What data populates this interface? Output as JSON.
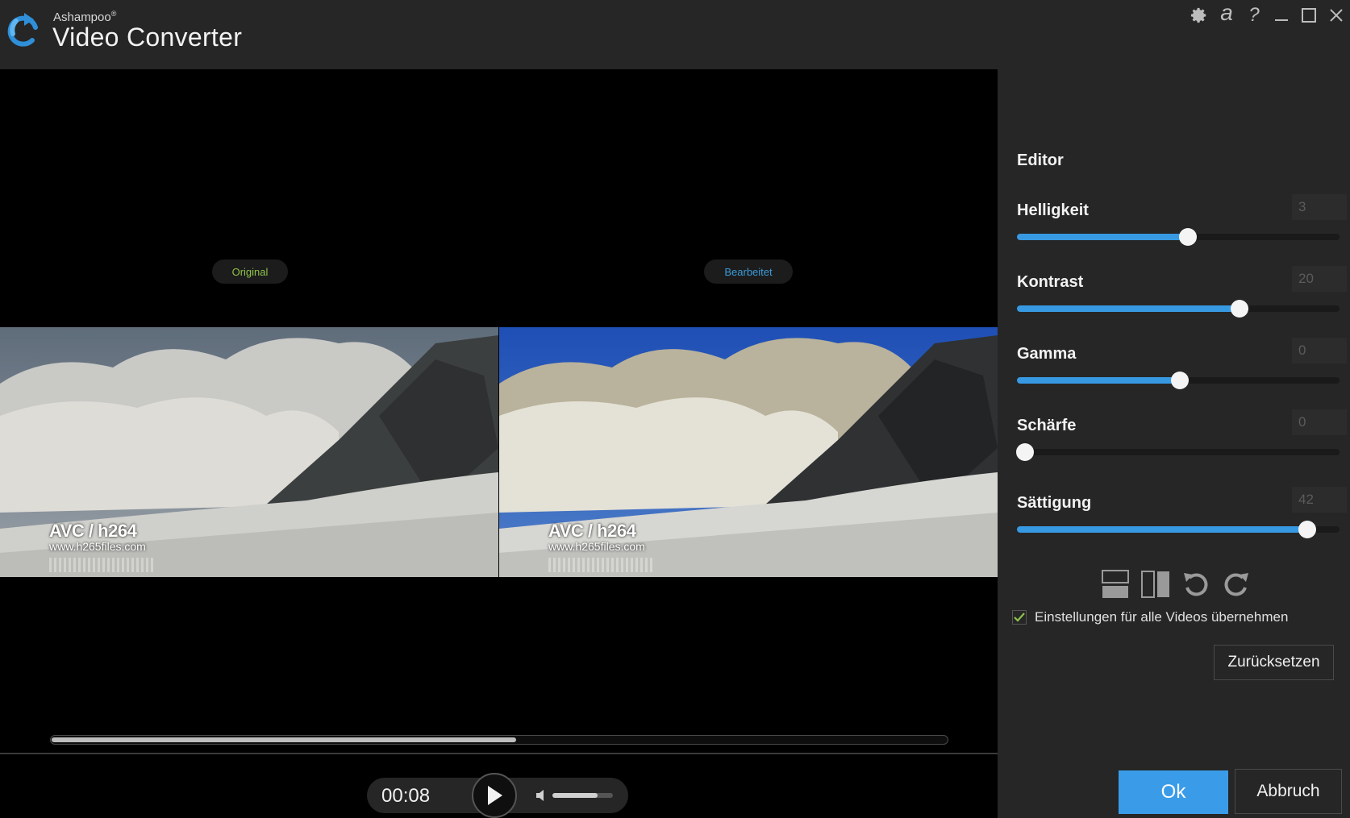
{
  "app": {
    "brand": "Ashampoo",
    "brand_mark": "®",
    "title": "Video Converter"
  },
  "window_controls": [
    "gear-icon",
    "ashampoo-a-icon",
    "help-icon",
    "minimize-icon",
    "maximize-icon",
    "close-icon"
  ],
  "window_controls_text": {
    "a": "a",
    "help": "?"
  },
  "preview": {
    "original_label": "Original",
    "edited_label": "Bearbeitet",
    "overlay_title": "AVC / h264",
    "overlay_url": "www.h265files.com"
  },
  "player": {
    "time": "00:08",
    "progress": 0.52,
    "volume": 0.75
  },
  "editor": {
    "title": "Editor",
    "params": [
      {
        "label": "Helligkeit",
        "value": "3",
        "position": 0.53
      },
      {
        "label": "Kontrast",
        "value": "20",
        "position": 0.69
      },
      {
        "label": "Gamma",
        "value": "0",
        "position": 0.505
      },
      {
        "label": "Schärfe",
        "value": "0",
        "position": 0.025
      },
      {
        "label": "Sättigung",
        "value": "42",
        "position": 0.9
      }
    ],
    "tools": [
      "split-horizontal-icon",
      "split-vertical-icon",
      "rotate-left-icon",
      "rotate-right-icon"
    ],
    "apply_all_label": "Einstellungen für alle Videos übernehmen",
    "apply_all_checked": true,
    "reset_label": "Zurücksetzen",
    "ok_label": "Ok",
    "cancel_label": "Abbruch"
  },
  "colors": {
    "accent": "#3a9ce8",
    "original_label": "#8fc24a",
    "edited_label": "#3a9ad9",
    "checkmark": "#8fc24a"
  }
}
